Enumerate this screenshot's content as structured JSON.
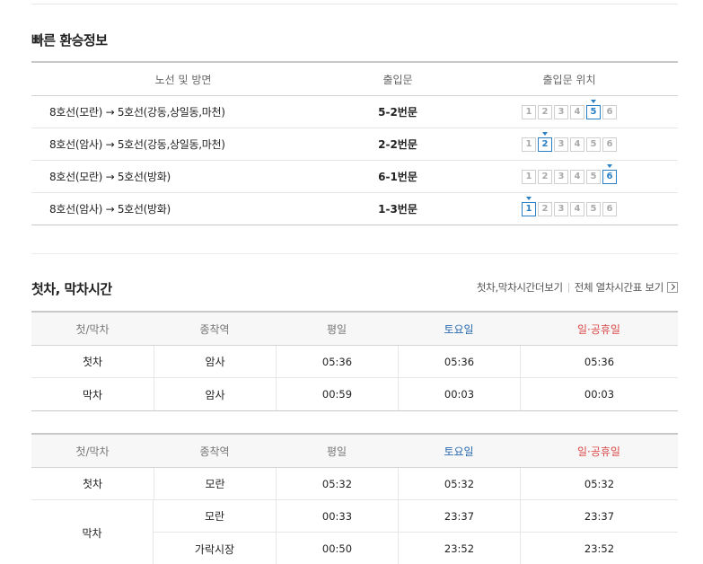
{
  "transfer": {
    "title": "빠른 환승정보",
    "headers": {
      "route": "노선 및 방면",
      "exit": "출입문",
      "position": "출입문 위치"
    },
    "rows": [
      {
        "route": "8호선(모란) → 5호선(강동,상일동,마천)",
        "exit": "5-2번문",
        "active_car": 5
      },
      {
        "route": "8호선(암사) → 5호선(강동,상일동,마천)",
        "exit": "2-2번문",
        "active_car": 2
      },
      {
        "route": "8호선(모란) → 5호선(방화)",
        "exit": "6-1번문",
        "active_car": 6
      },
      {
        "route": "8호선(암사) → 5호선(방화)",
        "exit": "1-3번문",
        "active_car": 1
      }
    ],
    "car_numbers": [
      "1",
      "2",
      "3",
      "4",
      "5",
      "6"
    ],
    "accent_color": "#2b7fc4"
  },
  "schedule": {
    "title": "첫차, 막차시간",
    "link_more": "첫차,막차시간더보기",
    "link_full": "전체 열차시간표 보기",
    "headers": {
      "type": "첫/막차",
      "terminal": "종착역",
      "weekday": "평일",
      "saturday": "토요일",
      "holiday": "일·공휴일"
    },
    "colors": {
      "saturday": "#2a6bb0",
      "holiday": "#d94848"
    },
    "table1": [
      {
        "type": "첫차",
        "terminal": "암사",
        "weekday": "05:36",
        "saturday": "05:36",
        "holiday": "05:36"
      },
      {
        "type": "막차",
        "terminal": "암사",
        "weekday": "00:59",
        "saturday": "00:03",
        "holiday": "00:03"
      }
    ],
    "table2": {
      "first": {
        "type": "첫차",
        "terminal": "모란",
        "weekday": "05:32",
        "saturday": "05:32",
        "holiday": "05:32"
      },
      "last_type": "막차",
      "last": [
        {
          "terminal": "모란",
          "weekday": "00:33",
          "saturday": "23:37",
          "holiday": "23:37"
        },
        {
          "terminal": "가락시장",
          "weekday": "00:50",
          "saturday": "23:52",
          "holiday": "23:52"
        }
      ]
    }
  }
}
